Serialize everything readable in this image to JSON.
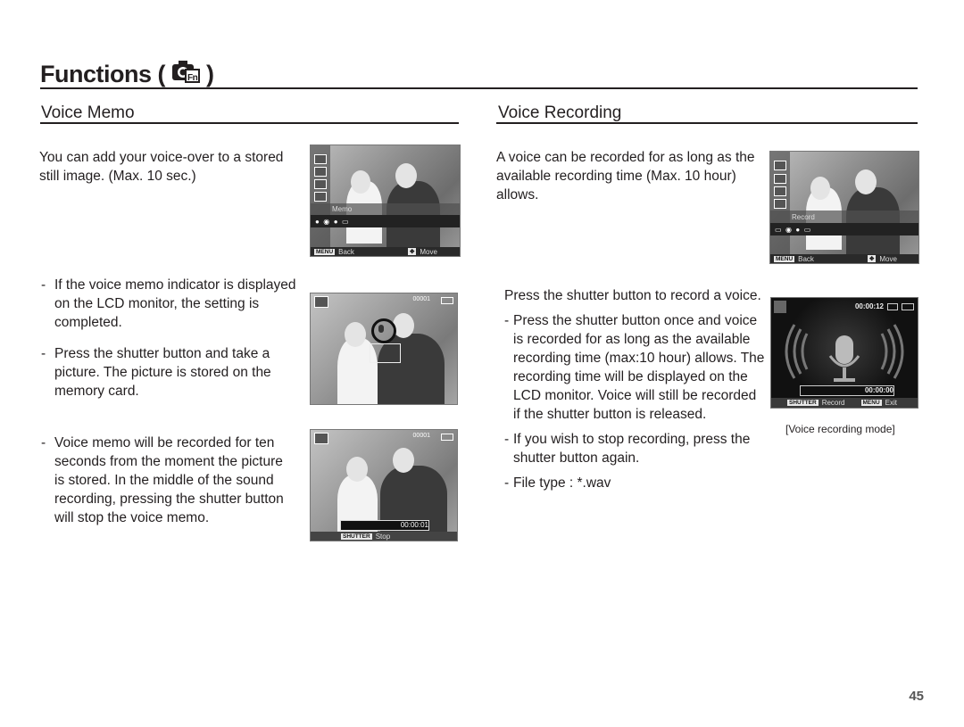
{
  "header": {
    "title": "Functions (",
    "title_close": ")",
    "icon": "camera-function-icon"
  },
  "voice_memo": {
    "heading": "Voice Memo",
    "intro": [
      "You can add your voice-over to a stored",
      "still image. (Max. 10 sec.)"
    ],
    "bullets": [
      [
        "If the voice memo indicator is displayed",
        "on the LCD monitor, the setting is",
        "completed."
      ],
      [
        "Press the shutter button and take a",
        "picture. The picture is stored on the",
        "memory card."
      ],
      [
        "Voice memo will be recorded for ten",
        "seconds from the moment the picture",
        "is stored. In the middle of the sound",
        "recording, pressing the shutter button",
        "will stop the voice memo."
      ]
    ],
    "screen1": {
      "menu_label": "Memo",
      "back_key": "MENU",
      "back_label": "Back",
      "move_label": "Move"
    },
    "screen2": {
      "frame_count": "00001"
    },
    "screen3": {
      "frame_count": "00001",
      "timer": "00:00:01",
      "key": "SHUTTER",
      "stop_label": "Stop"
    }
  },
  "voice_recording": {
    "heading": "Voice Recording",
    "intro": [
      "A voice can be recorded for as long as the",
      "available recording time (Max. 10 hour)",
      "allows."
    ],
    "lead": "Press the shutter button to record a voice.",
    "bullets": [
      [
        "Press the shutter button once and voice",
        "is recorded for as long as the available",
        "recording time (max:10 hour) allows. The",
        "recording time will be displayed on the",
        "LCD monitor. Voice will still be recorded",
        "if the shutter button is released."
      ],
      [
        "If you wish to stop recording, press the",
        "shutter button again."
      ],
      [
        "File type : *.wav"
      ]
    ],
    "screen1": {
      "menu_label": "Record",
      "back_key": "MENU",
      "back_label": "Back",
      "move_label": "Move"
    },
    "screen2": {
      "remaining": "00:00:12",
      "elapsed": "00:00:00",
      "shutter_key": "SHUTTER",
      "record_label": "Record",
      "menu_key": "MENU",
      "exit_label": "Exit"
    },
    "caption": "[Voice recording mode]"
  },
  "dash": "-",
  "page_number": "45"
}
